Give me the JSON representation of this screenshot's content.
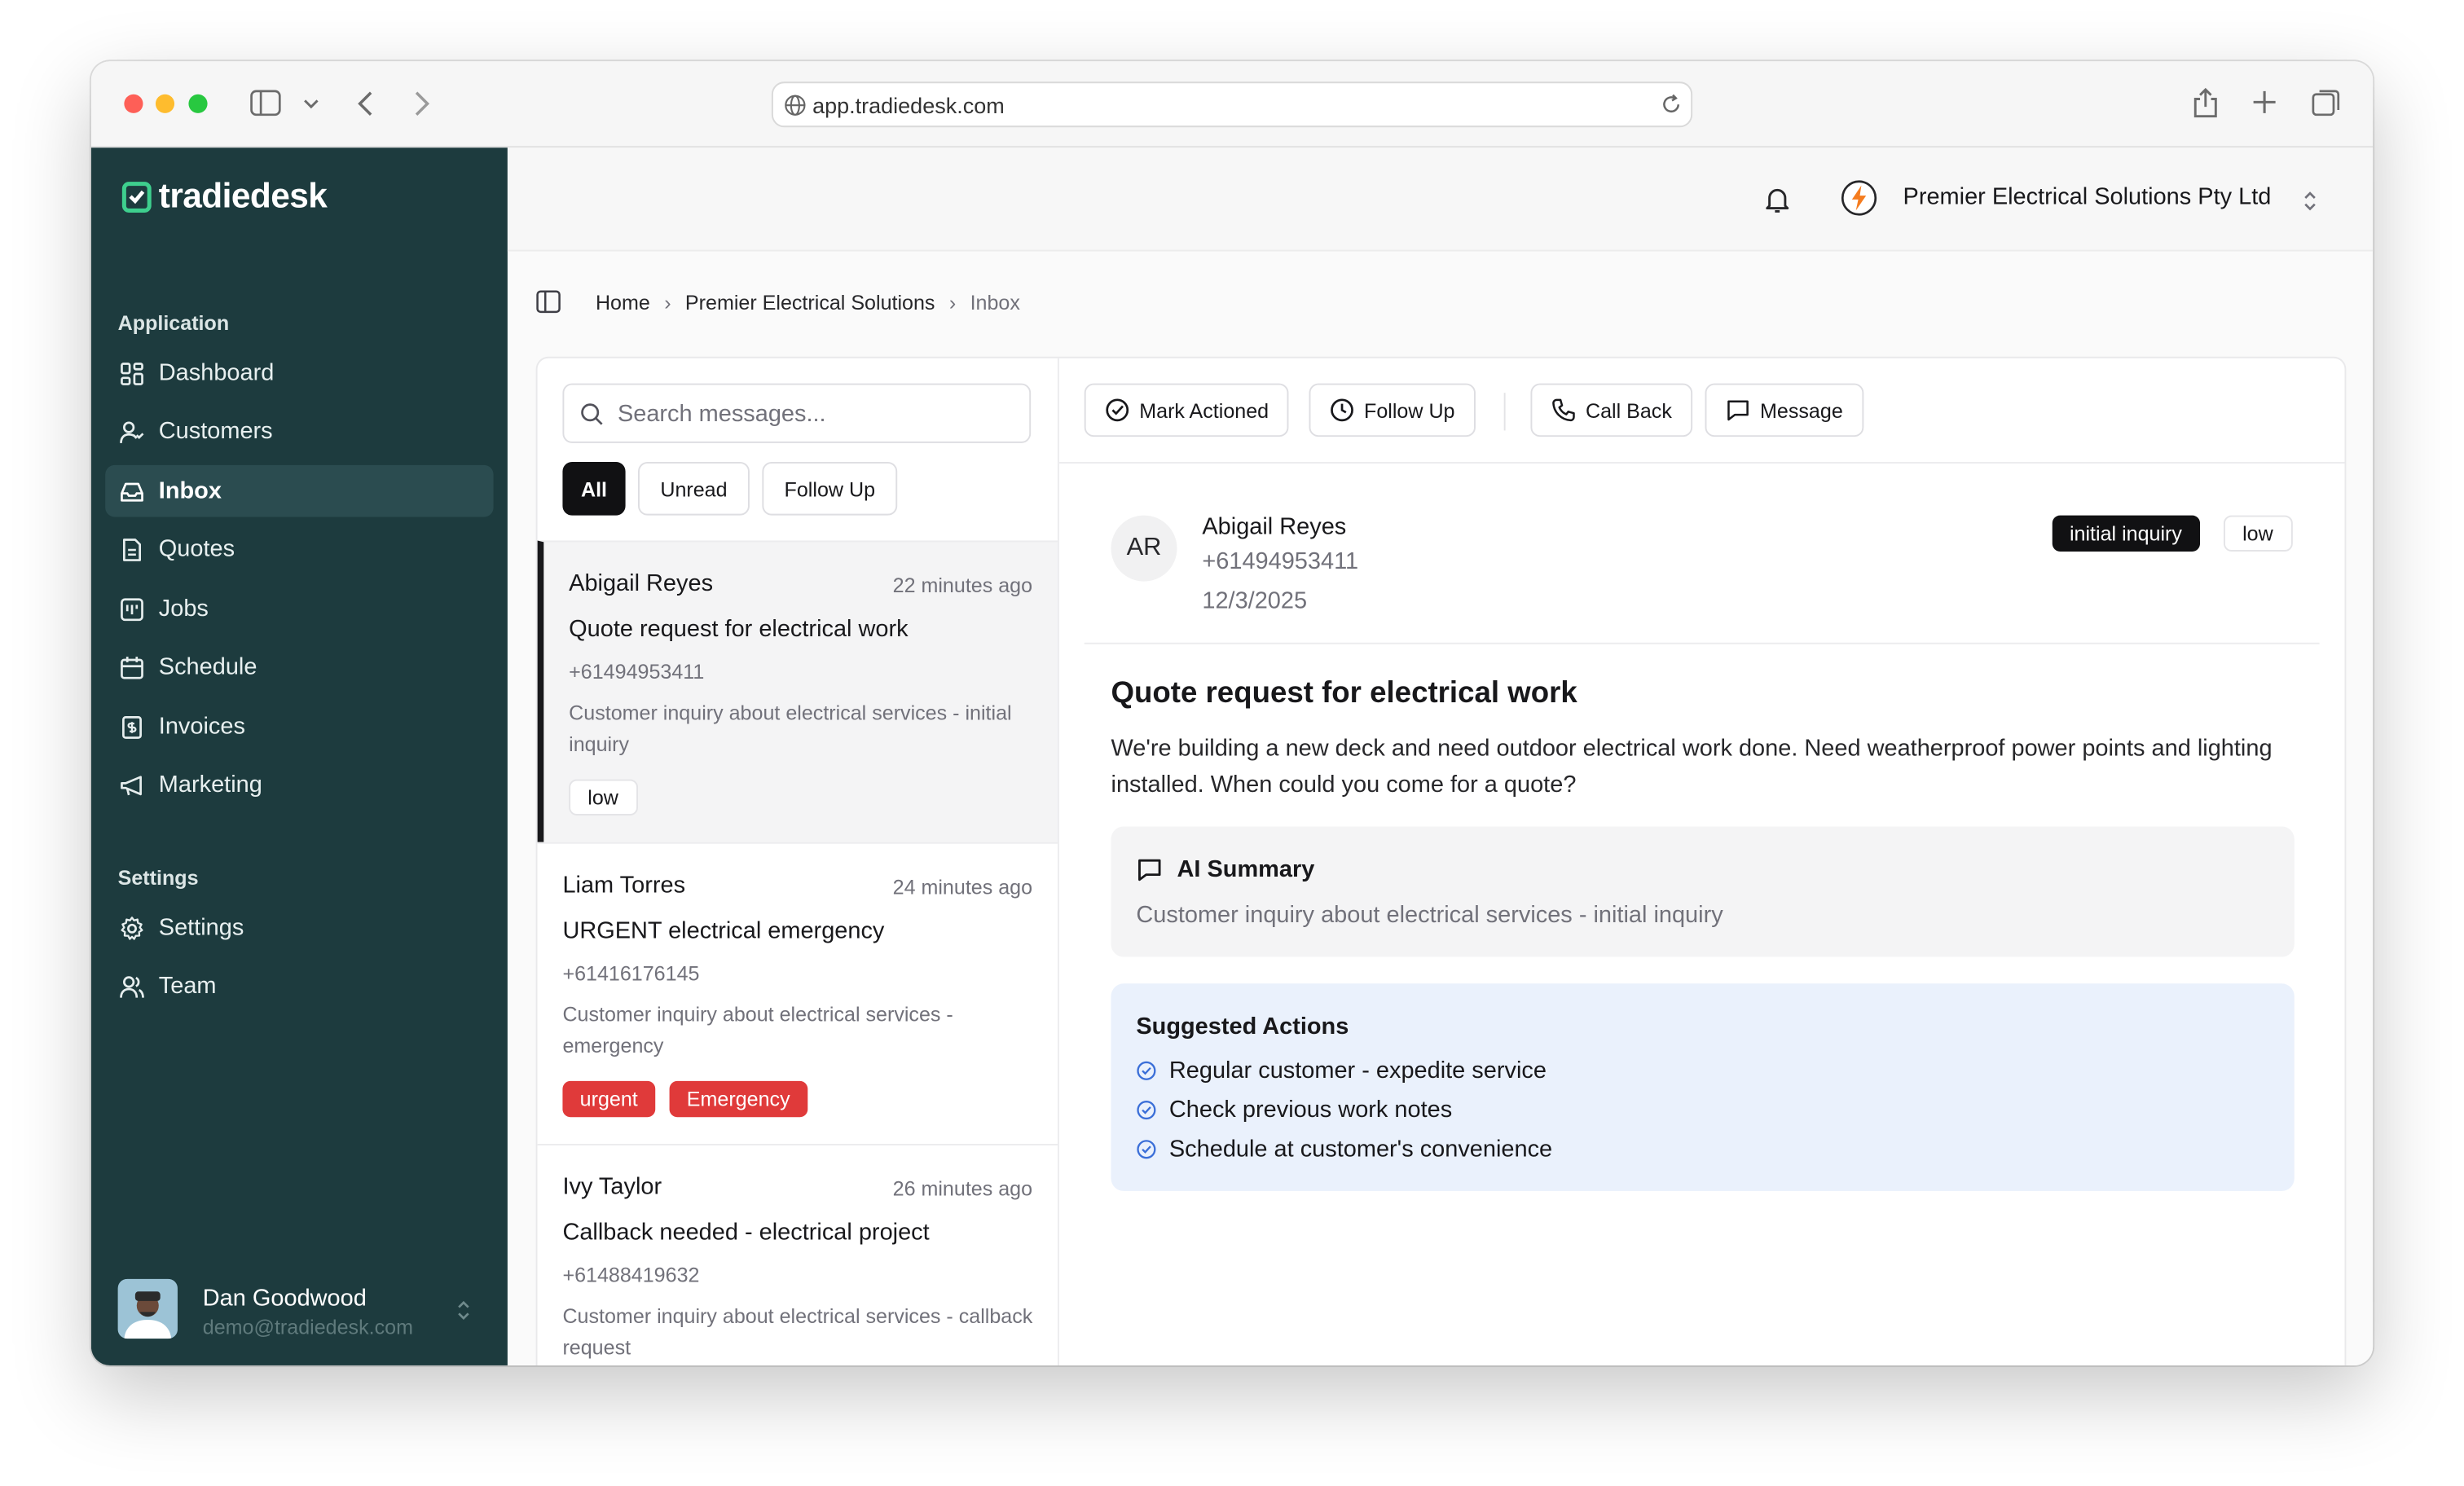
{
  "browser": {
    "url": "app.tradiedesk.com"
  },
  "sidebar": {
    "logo_text": "tradiedesk",
    "application_label": "Application",
    "settings_label": "Settings",
    "items": [
      {
        "label": "Dashboard",
        "icon": "dashboard-icon"
      },
      {
        "label": "Customers",
        "icon": "customers-icon"
      },
      {
        "label": "Inbox",
        "icon": "inbox-icon",
        "active": true
      },
      {
        "label": "Quotes",
        "icon": "quotes-icon"
      },
      {
        "label": "Jobs",
        "icon": "jobs-icon"
      },
      {
        "label": "Schedule",
        "icon": "calendar-icon"
      },
      {
        "label": "Invoices",
        "icon": "invoice-icon"
      },
      {
        "label": "Marketing",
        "icon": "megaphone-icon"
      }
    ],
    "settings_items": [
      {
        "label": "Settings",
        "icon": "gear-icon"
      },
      {
        "label": "Team",
        "icon": "team-icon"
      }
    ],
    "user": {
      "name": "Dan Goodwood",
      "email": "demo@tradiedesk.com"
    }
  },
  "topbar": {
    "company": "Premier Electrical Solutions Pty Ltd"
  },
  "breadcrumb": {
    "home": "Home",
    "org": "Premier Electrical Solutions",
    "current": "Inbox"
  },
  "inbox": {
    "search_placeholder": "Search messages...",
    "filters": [
      "All",
      "Unread",
      "Follow Up"
    ],
    "messages": [
      {
        "name": "Abigail Reyes",
        "time": "22 minutes ago",
        "subject": "Quote request for electrical work",
        "phone": "+61494953411",
        "preview": "Customer inquiry about electrical services - initial inquiry",
        "tags": [
          "low"
        ]
      },
      {
        "name": "Liam Torres",
        "time": "24 minutes ago",
        "subject": "URGENT electrical emergency",
        "phone": "+61416176145",
        "preview": "Customer inquiry about electrical services - emergency",
        "tags": [
          "urgent",
          "Emergency"
        ]
      },
      {
        "name": "Ivy Taylor",
        "time": "26 minutes ago",
        "subject": "Callback needed - electrical project",
        "phone": "+61488419632",
        "preview": "Customer inquiry about electrical services - callback request",
        "tags": []
      }
    ]
  },
  "detail": {
    "actions": {
      "mark_actioned": "Mark Actioned",
      "follow_up": "Follow Up",
      "call_back": "Call Back",
      "message": "Message"
    },
    "initials": "AR",
    "name": "Abigail Reyes",
    "phone": "+61494953411",
    "date": "12/3/2025",
    "category_badge": "initial inquiry",
    "priority_badge": "low",
    "subject": "Quote request for electrical work",
    "body": "We're building a new deck and need outdoor electrical work done. Need weatherproof power points and lighting installed. When could you come for a quote?",
    "ai_summary_title": "AI Summary",
    "ai_summary_text": "Customer inquiry about electrical services - initial inquiry",
    "suggested_title": "Suggested Actions",
    "suggested_actions": [
      "Regular customer - expedite service",
      "Check previous work notes",
      "Schedule at customer's convenience"
    ]
  },
  "colors": {
    "sidebar_bg": "#1d3b3e",
    "accent_green": "#3ecf8e",
    "urgent_red": "#e03a3a",
    "suggest_bg": "#eaf1fc",
    "check_blue": "#3b6fd8"
  }
}
